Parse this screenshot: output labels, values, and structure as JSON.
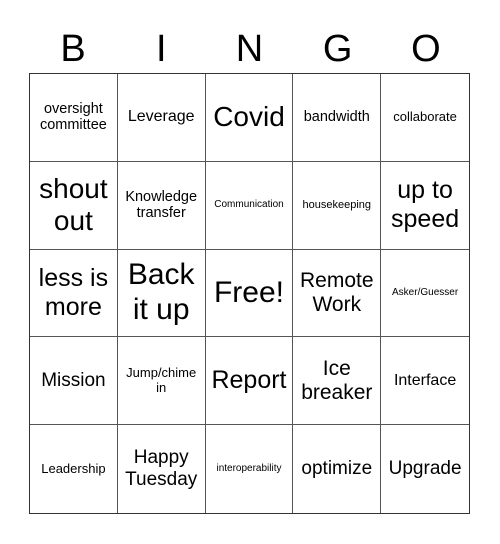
{
  "header": [
    "B",
    "I",
    "N",
    "G",
    "O"
  ],
  "cells": [
    {
      "text": "oversight committee",
      "size": "s14"
    },
    {
      "text": "Leverage",
      "size": "s16"
    },
    {
      "text": "Covid",
      "size": "s28"
    },
    {
      "text": "bandwidth",
      "size": "s14"
    },
    {
      "text": "collaborate",
      "size": "s13"
    },
    {
      "text": "shout out",
      "size": "s28"
    },
    {
      "text": "Knowledge transfer",
      "size": "s14"
    },
    {
      "text": "Communication",
      "size": "s10"
    },
    {
      "text": "housekeeping",
      "size": "s11"
    },
    {
      "text": "up to speed",
      "size": "s25"
    },
    {
      "text": "less is more",
      "size": "s25"
    },
    {
      "text": "Back it up",
      "size": "s30"
    },
    {
      "text": "Free!",
      "size": "s30"
    },
    {
      "text": "Remote Work",
      "size": "s21"
    },
    {
      "text": "Asker/Guesser",
      "size": "s10"
    },
    {
      "text": "Mission",
      "size": "s19"
    },
    {
      "text": "Jump/chime in",
      "size": "s13"
    },
    {
      "text": "Report",
      "size": "s25"
    },
    {
      "text": "Ice breaker",
      "size": "s21"
    },
    {
      "text": "Interface",
      "size": "s16"
    },
    {
      "text": "Leadership",
      "size": "s13"
    },
    {
      "text": "Happy Tuesday",
      "size": "s19"
    },
    {
      "text": "interoperability",
      "size": "s10"
    },
    {
      "text": "optimize",
      "size": "s19"
    },
    {
      "text": "Upgrade",
      "size": "s19"
    }
  ]
}
